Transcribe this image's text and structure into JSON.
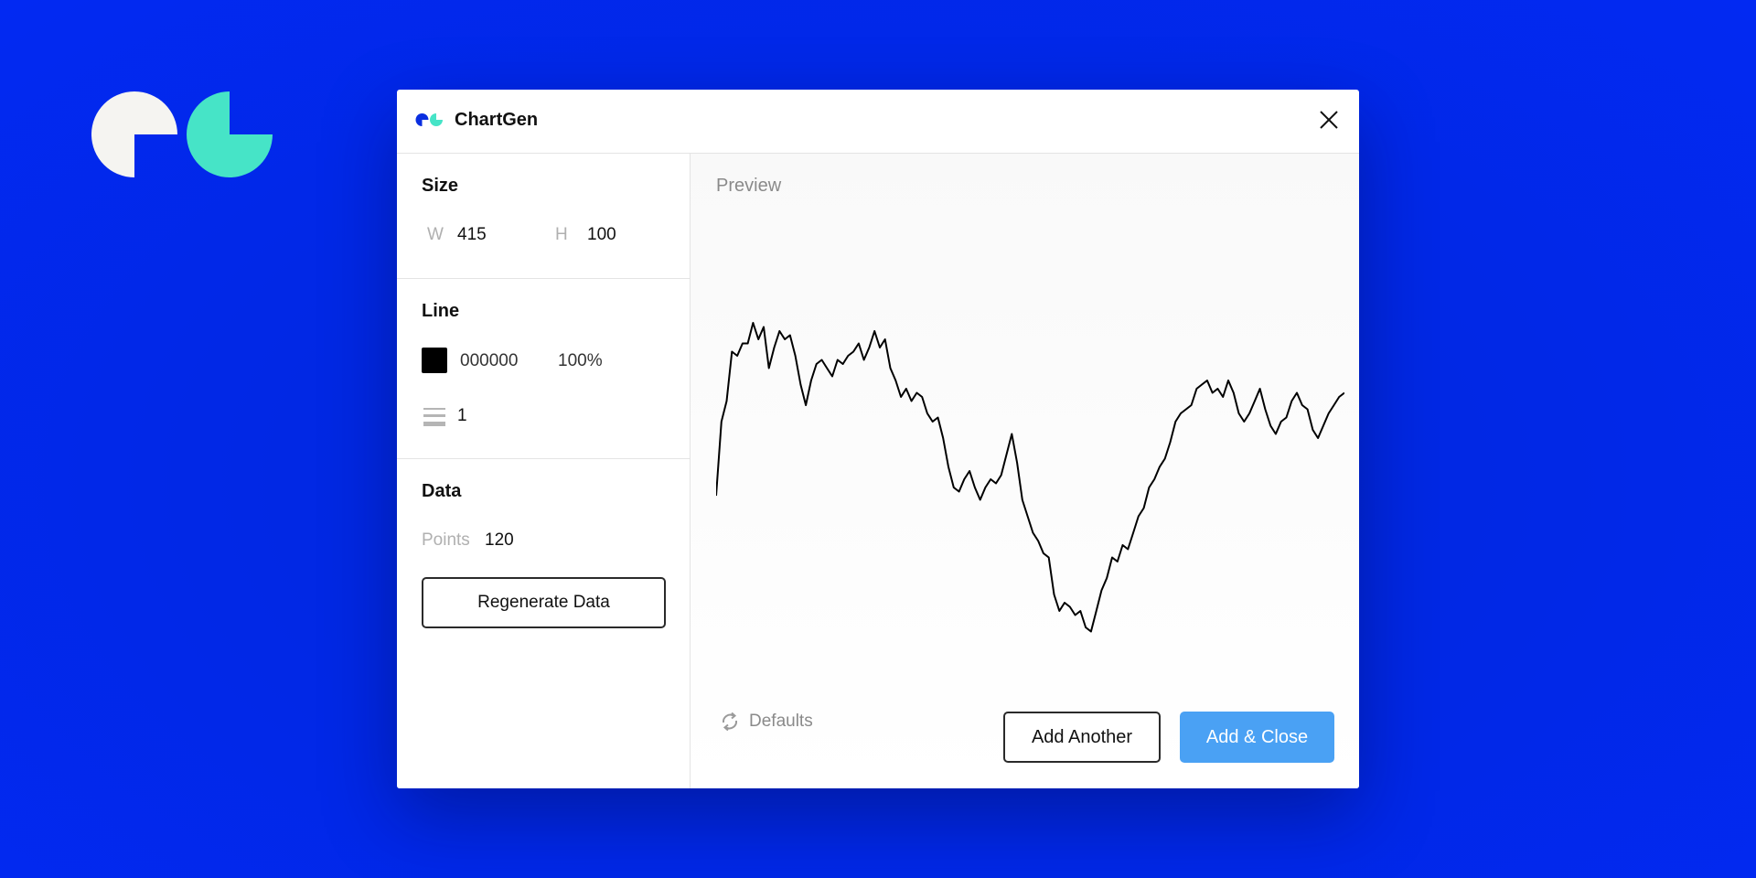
{
  "colors": {
    "background": "#0129e6",
    "logo_left": "#f5f4f1",
    "logo_right": "#46e4c7",
    "accent_button": "#4aa1f4",
    "line_color": "#000000"
  },
  "app": {
    "title": "ChartGen"
  },
  "size": {
    "heading": "Size",
    "w_label": "W",
    "w_value": "415",
    "h_label": "H",
    "h_value": "100"
  },
  "line": {
    "heading": "Line",
    "color_hex": "000000",
    "opacity": "100%",
    "stroke_width": "1"
  },
  "data_section": {
    "heading": "Data",
    "points_label": "Points",
    "points_value": "120",
    "regenerate_label": "Regenerate Data"
  },
  "preview": {
    "label": "Preview"
  },
  "footer": {
    "defaults_label": "Defaults",
    "add_another_label": "Add Another",
    "add_close_label": "Add & Close"
  },
  "icons": [
    "chartgen-logo-icon",
    "close-icon",
    "stroke-width-icon",
    "refresh-icon"
  ],
  "chart_data": {
    "type": "line",
    "x": [
      1,
      2,
      3,
      4,
      5,
      6,
      7,
      8,
      9,
      10,
      11,
      12,
      13,
      14,
      15,
      16,
      17,
      18,
      19,
      20,
      21,
      22,
      23,
      24,
      25,
      26,
      27,
      28,
      29,
      30,
      31,
      32,
      33,
      34,
      35,
      36,
      37,
      38,
      39,
      40,
      41,
      42,
      43,
      44,
      45,
      46,
      47,
      48,
      49,
      50,
      51,
      52,
      53,
      54,
      55,
      56,
      57,
      58,
      59,
      60,
      61,
      62,
      63,
      64,
      65,
      66,
      67,
      68,
      69,
      70,
      71,
      72,
      73,
      74,
      75,
      76,
      77,
      78,
      79,
      80,
      81,
      82,
      83,
      84,
      85,
      86,
      87,
      88,
      89,
      90,
      91,
      92,
      93,
      94,
      95,
      96,
      97,
      98,
      99,
      100,
      101,
      102,
      103,
      104,
      105,
      106,
      107,
      108,
      109,
      110,
      111,
      112,
      113,
      114,
      115,
      116,
      117,
      118,
      119,
      120
    ],
    "values": [
      38,
      56,
      61,
      73,
      72,
      75,
      75,
      80,
      76,
      79,
      69,
      74,
      78,
      76,
      77,
      72,
      65,
      60,
      66,
      70,
      71,
      69,
      67,
      71,
      70,
      72,
      73,
      75,
      71,
      74,
      78,
      74,
      76,
      69,
      66,
      62,
      64,
      61,
      63,
      62,
      58,
      56,
      57,
      52,
      45,
      40,
      39,
      42,
      44,
      40,
      37,
      40,
      42,
      41,
      43,
      48,
      53,
      46,
      37,
      33,
      29,
      27,
      24,
      23,
      14,
      10,
      12,
      11,
      9,
      10,
      6,
      5,
      10,
      15,
      18,
      23,
      22,
      26,
      25,
      29,
      33,
      35,
      40,
      42,
      45,
      47,
      51,
      56,
      58,
      59,
      60,
      64,
      65,
      66,
      63,
      64,
      62,
      66,
      63,
      58,
      56,
      58,
      61,
      64,
      59,
      55,
      53,
      56,
      57,
      61,
      63,
      60,
      59,
      54,
      52,
      55,
      58,
      60,
      62,
      63
    ],
    "xlim": [
      1,
      120
    ],
    "ylim": [
      0,
      100
    ],
    "line_width": 1,
    "grid": false,
    "title": "",
    "xlabel": "",
    "ylabel": ""
  }
}
